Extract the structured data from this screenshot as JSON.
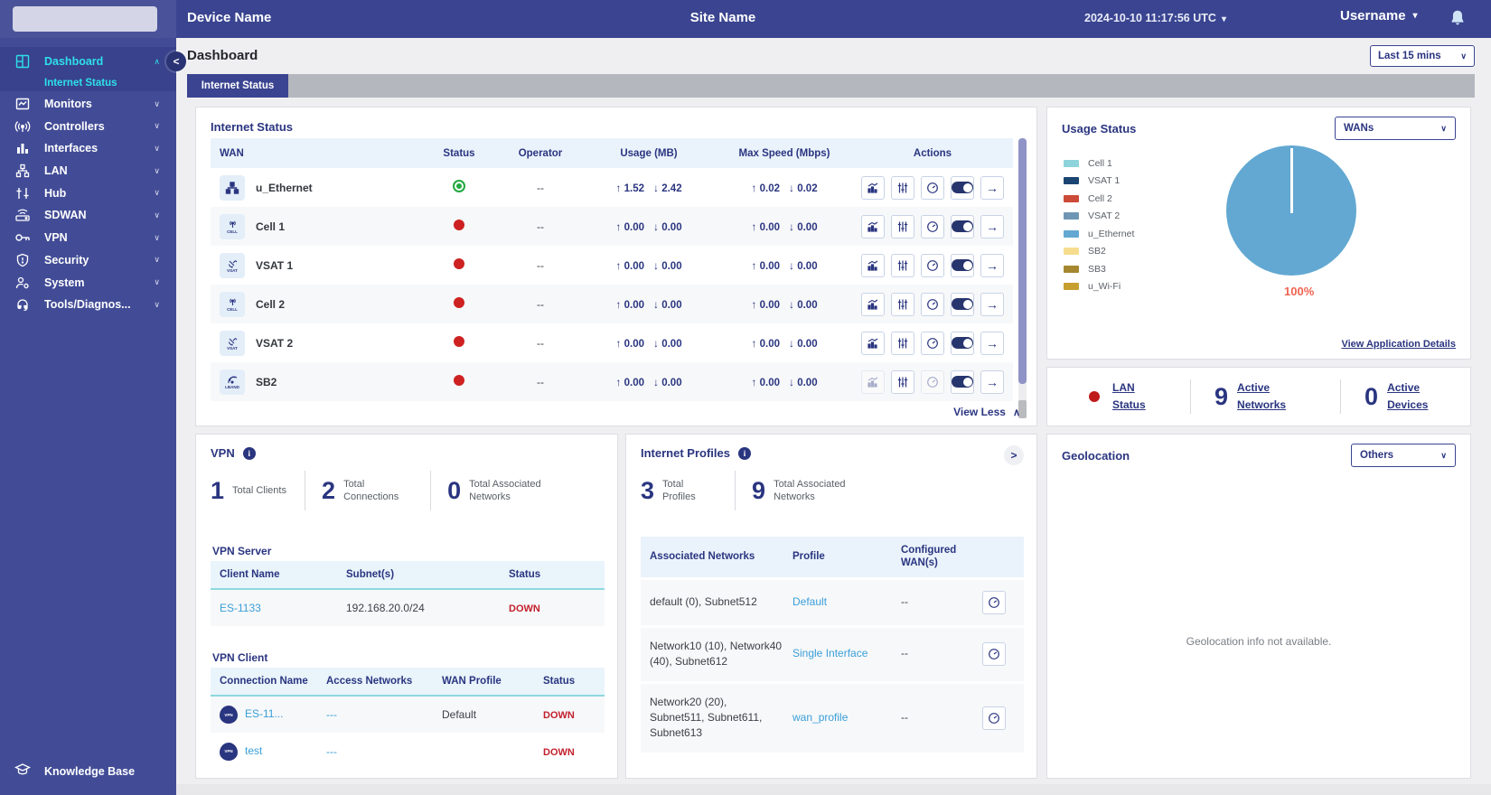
{
  "header": {
    "device_name": "Device Name",
    "site_name": "Site Name",
    "datetime": "2024-10-10 11:17:56 UTC",
    "username": "Username"
  },
  "sidebar": {
    "items": [
      {
        "label": "Dashboard",
        "icon": "dashboard-icon",
        "active": true,
        "chevron": "up"
      },
      {
        "label": "Monitors",
        "icon": "monitors-icon",
        "chevron": "down"
      },
      {
        "label": "Controllers",
        "icon": "controllers-icon",
        "chevron": "down"
      },
      {
        "label": "Interfaces",
        "icon": "interfaces-icon",
        "chevron": "down"
      },
      {
        "label": "LAN",
        "icon": "lan-icon",
        "chevron": "down"
      },
      {
        "label": "Hub",
        "icon": "hub-icon",
        "chevron": "down"
      },
      {
        "label": "SDWAN",
        "icon": "sdwan-icon",
        "chevron": "down"
      },
      {
        "label": "VPN",
        "icon": "vpn-icon",
        "chevron": "down"
      },
      {
        "label": "Security",
        "icon": "security-icon",
        "chevron": "down"
      },
      {
        "label": "System",
        "icon": "system-icon",
        "chevron": "down"
      },
      {
        "label": "Tools/Diagnos...",
        "icon": "tools-icon",
        "chevron": "down"
      }
    ],
    "active_sub": "Internet Status",
    "footer": "Knowledge Base"
  },
  "page": {
    "title": "Dashboard",
    "time_range": "Last 15 mins",
    "tab": "Internet Status"
  },
  "internet_status": {
    "title": "Internet Status",
    "columns": {
      "wan": "WAN",
      "status": "Status",
      "operator": "Operator",
      "usage": "Usage (MB)",
      "max_speed": "Max Speed (Mbps)",
      "actions": "Actions"
    },
    "rows": [
      {
        "name": "u_Ethernet",
        "icon": "ethernet-icon",
        "caption": "",
        "status": "up",
        "operator": "--",
        "usage_up": "1.52",
        "usage_down": "2.42",
        "speed_up": "0.02",
        "speed_down": "0.02"
      },
      {
        "name": "Cell 1",
        "icon": "cell-icon",
        "caption": "CELL",
        "status": "down",
        "operator": "--",
        "usage_up": "0.00",
        "usage_down": "0.00",
        "speed_up": "0.00",
        "speed_down": "0.00"
      },
      {
        "name": "VSAT 1",
        "icon": "vsat-icon",
        "caption": "VSAT",
        "status": "down",
        "operator": "--",
        "usage_up": "0.00",
        "usage_down": "0.00",
        "speed_up": "0.00",
        "speed_down": "0.00"
      },
      {
        "name": "Cell 2",
        "icon": "cell-icon",
        "caption": "CELL",
        "status": "down",
        "operator": "--",
        "usage_up": "0.00",
        "usage_down": "0.00",
        "speed_up": "0.00",
        "speed_down": "0.00"
      },
      {
        "name": "VSAT 2",
        "icon": "vsat-icon",
        "caption": "VSAT",
        "status": "down",
        "operator": "--",
        "usage_up": "0.00",
        "usage_down": "0.00",
        "speed_up": "0.00",
        "speed_down": "0.00"
      },
      {
        "name": "SB2",
        "icon": "lband-icon",
        "caption": "LBAND",
        "status": "down",
        "operator": "--",
        "usage_up": "0.00",
        "usage_down": "0.00",
        "speed_up": "0.00",
        "speed_down": "0.00",
        "partial_disabled": true
      }
    ],
    "view_less": "View Less"
  },
  "usage_status": {
    "title": "Usage Status",
    "selector": "WANs",
    "legend": [
      {
        "label": "Cell 1",
        "color": "#8DD3DB"
      },
      {
        "label": "VSAT 1",
        "color": "#1A4472"
      },
      {
        "label": "Cell 2",
        "color": "#CC4A38"
      },
      {
        "label": "VSAT 2",
        "color": "#6E96B4"
      },
      {
        "label": "u_Ethernet",
        "color": "#62A8D2"
      },
      {
        "label": "SB2",
        "color": "#F6DC8F"
      },
      {
        "label": "SB3",
        "color": "#A5872F"
      },
      {
        "label": "u_Wi-Fi",
        "color": "#C79F2F"
      }
    ],
    "chart_data": {
      "type": "pie",
      "slices": [
        {
          "label": "u_Ethernet",
          "value": 100,
          "color": "#62A8D2"
        }
      ],
      "label": "100%",
      "label_color": "#EF6352"
    },
    "link": "View Application Details"
  },
  "lan_status": {
    "status_label": "LAN Status",
    "networks_value": "9",
    "networks_label": "Active Networks",
    "devices_value": "0",
    "devices_label": "Active Devices"
  },
  "vpn": {
    "title": "VPN",
    "stats": [
      {
        "value": "1",
        "label": "Total Clients"
      },
      {
        "value": "2",
        "label": "Total Connections"
      },
      {
        "value": "0",
        "label": "Total Associated Networks"
      }
    ],
    "server": {
      "subtitle": "VPN Server",
      "columns": {
        "client": "Client Name",
        "subnets": "Subnet(s)",
        "status": "Status"
      },
      "rows": [
        {
          "client": "ES-1133",
          "subnets": "192.168.20.0/24",
          "status": "DOWN"
        }
      ]
    },
    "client": {
      "subtitle": "VPN Client",
      "columns": {
        "name": "Connection Name",
        "access": "Access Networks",
        "profile": "WAN Profile",
        "status": "Status"
      },
      "rows": [
        {
          "name": "ES-11...",
          "access": "---",
          "profile": "Default",
          "status": "DOWN"
        },
        {
          "name": "test",
          "access": "---",
          "profile": "",
          "status": "DOWN"
        }
      ]
    }
  },
  "internet_profiles": {
    "title": "Internet Profiles",
    "stats": [
      {
        "value": "3",
        "label": "Total Profiles"
      },
      {
        "value": "9",
        "label": "Total Associated Networks"
      }
    ],
    "columns": {
      "networks": "Associated Networks",
      "profile": "Profile",
      "wans": "Configured WAN(s)"
    },
    "rows": [
      {
        "networks": "default (0), Subnet512",
        "profile": "Default",
        "wans": "--"
      },
      {
        "networks": "Network10 (10), Network40 (40), Subnet612",
        "profile": "Single Interface",
        "wans": "--"
      },
      {
        "networks": "Network20 (20), Subnet511, Subnet611, Subnet613",
        "profile": "wan_profile",
        "wans": "--"
      }
    ]
  },
  "geolocation": {
    "title": "Geolocation",
    "selector": "Others",
    "empty_text": "Geolocation info not available."
  },
  "glyphs": {
    "caret_down": "▾",
    "chevron_down": "∨",
    "chevron_up": "∧",
    "collapse": "<",
    "expand": ">",
    "arrow_up": "↑",
    "arrow_down": "↓",
    "arrow_right": "→"
  }
}
